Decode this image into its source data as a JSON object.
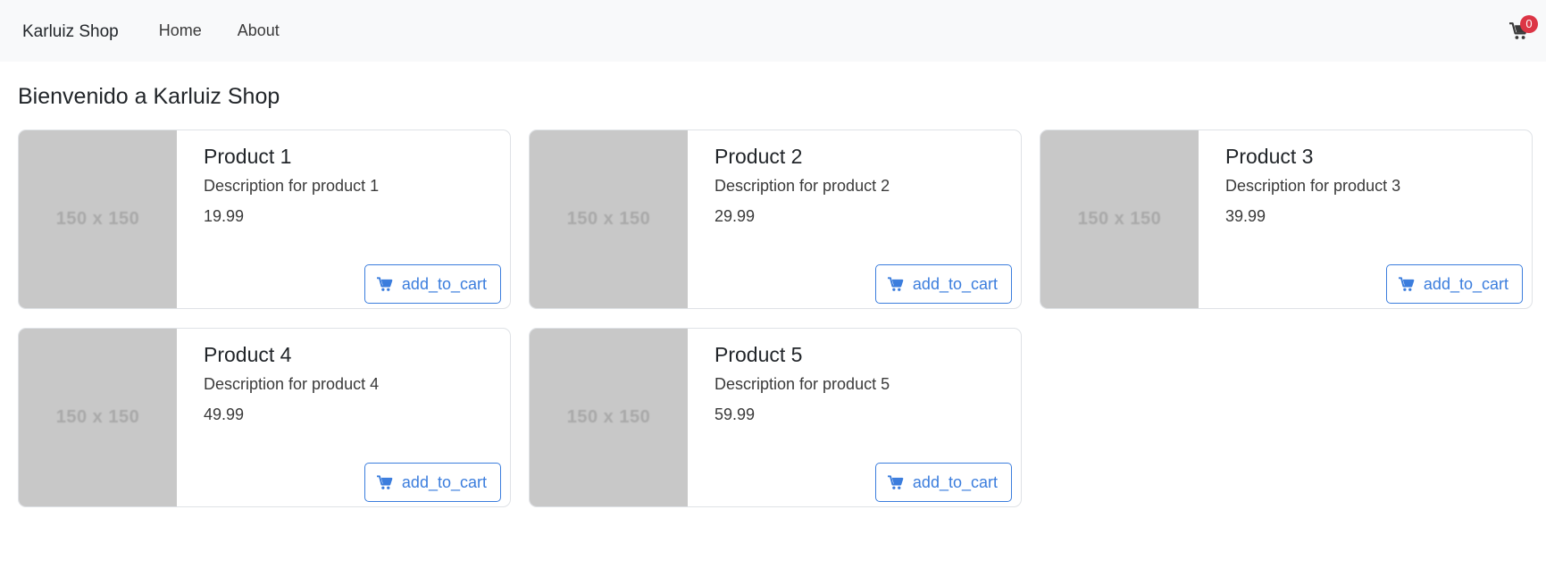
{
  "nav": {
    "brand": "Karluiz Shop",
    "links": [
      "Home",
      "About"
    ],
    "cart_icon": "shopping-cart-icon",
    "cart_count": "0"
  },
  "page": {
    "title": "Bienvenido a Karluiz Shop"
  },
  "products": [
    {
      "image_text": "150 x 150",
      "name": "Product 1",
      "description": "Description for product 1",
      "price": "19.99",
      "button_label": "add_to_cart"
    },
    {
      "image_text": "150 x 150",
      "name": "Product 2",
      "description": "Description for product 2",
      "price": "29.99",
      "button_label": "add_to_cart"
    },
    {
      "image_text": "150 x 150",
      "name": "Product 3",
      "description": "Description for product 3",
      "price": "39.99",
      "button_label": "add_to_cart"
    },
    {
      "image_text": "150 x 150",
      "name": "Product 4",
      "description": "Description for product 4",
      "price": "49.99",
      "button_label": "add_to_cart"
    },
    {
      "image_text": "150 x 150",
      "name": "Product 5",
      "description": "Description for product 5",
      "price": "59.99",
      "button_label": "add_to_cart"
    }
  ],
  "colors": {
    "accent": "#3b7ddd",
    "badge": "#dc3545",
    "navbar_bg": "#f8f9fa",
    "placeholder_bg": "#c8c8c8"
  }
}
